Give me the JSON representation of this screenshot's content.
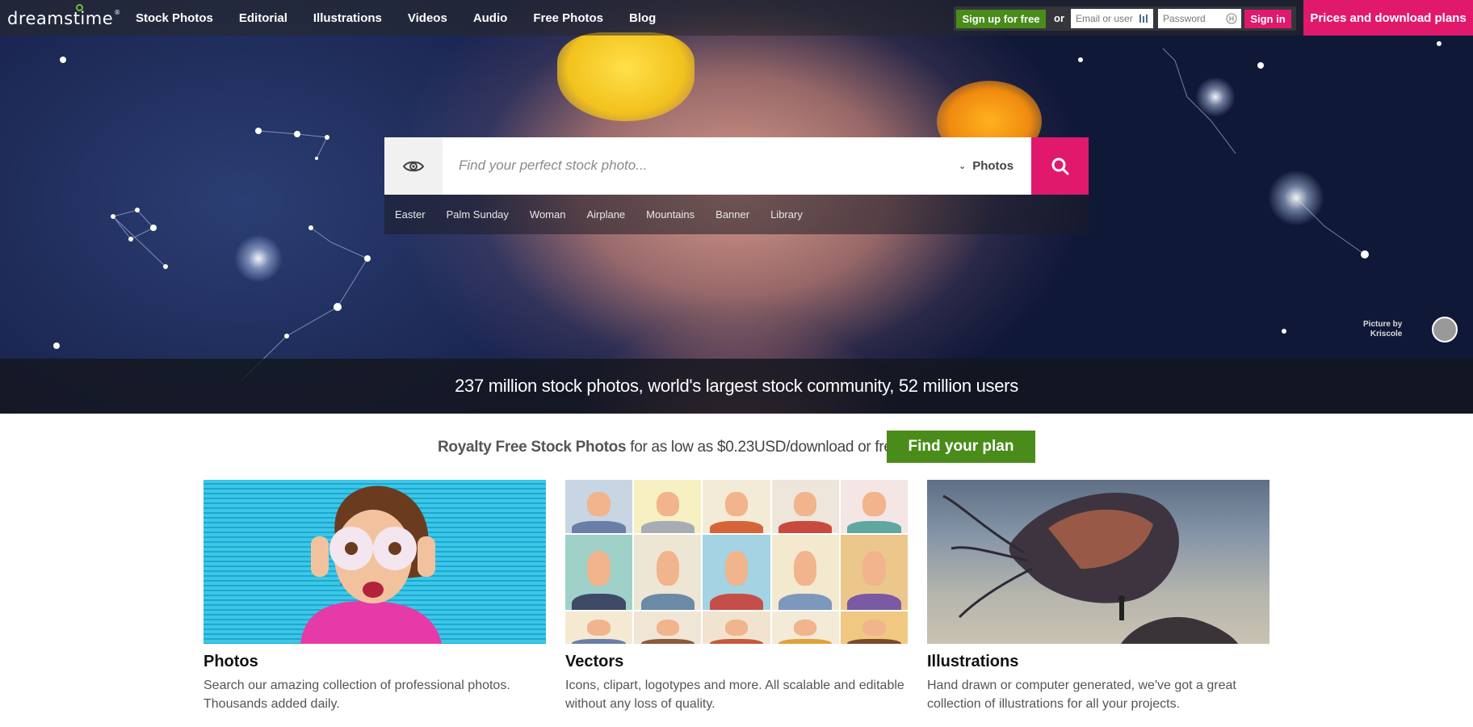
{
  "header": {
    "logo": "dreamstime",
    "logo_reg": "®",
    "nav": [
      "Stock Photos",
      "Editorial",
      "Illustrations",
      "Videos",
      "Audio",
      "Free Photos",
      "Blog"
    ],
    "signup_label": "Sign up for free",
    "or_label": "or",
    "email_placeholder": "Email or user",
    "password_placeholder": "Password",
    "signin_label": "Sign in",
    "prices_label": "Prices and download plans"
  },
  "search": {
    "placeholder": "Find your perfect stock photo...",
    "type_label": "Photos",
    "tags": [
      "Easter",
      "Palm Sunday",
      "Woman",
      "Airplane",
      "Mountains",
      "Banner",
      "Library"
    ]
  },
  "credit": {
    "line1": "Picture by",
    "line2": "Kriscole"
  },
  "stats": "237 million stock photos, world's largest stock community, 52 million users",
  "plan": {
    "bold": "Royalty Free Stock Photos",
    "rest": " for as low as $0.23USD/download or free",
    "button": "Find your plan"
  },
  "cards": [
    {
      "title": "Photos",
      "desc": "Search our amazing collection of professional photos. Thousands added daily."
    },
    {
      "title": "Vectors",
      "desc": "Icons, clipart, logotypes and more. All scalable and editable without any loss of quality."
    },
    {
      "title": "Illustrations",
      "desc": "Hand drawn or computer generated, we've got a great collection of illustrations for all your projects."
    }
  ],
  "colors": {
    "accent_pink": "#e0196d",
    "accent_green": "#4a8c1a",
    "hero_dark": "#1a2550"
  },
  "icons": {
    "search_icon": "search-icon",
    "eye_icon": "eye-icon",
    "chevron": "chevron-down-icon"
  }
}
